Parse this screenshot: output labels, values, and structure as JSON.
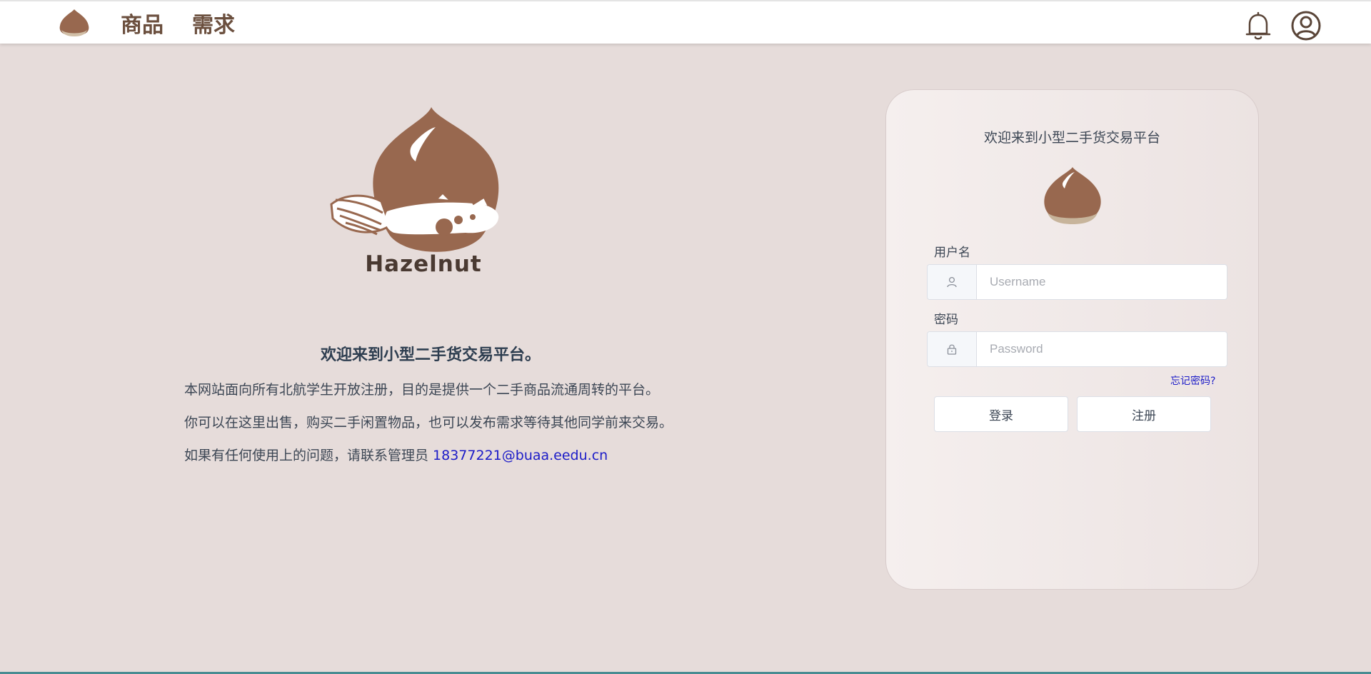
{
  "colors": {
    "page_background": "#e6dcda",
    "brand_brown": "#98684f",
    "nav_text": "#6b4f3e",
    "link_blue": "#1c1cc8"
  },
  "navbar": {
    "logo_icon": "hazelnut-icon",
    "links": [
      {
        "label": "商品"
      },
      {
        "label": "需求"
      }
    ],
    "notification_icon": "bell-icon",
    "profile_icon": "user-circle-icon"
  },
  "hero": {
    "logo_icon": "hazelnut-squirrel-logo",
    "wordmark": "Hazelnut",
    "title": "欢迎来到小型二手货交易平台。",
    "lines": [
      "本网站面向所有北航学生开放注册，目的是提供一个二手商品流通周转的平台。",
      "你可以在这里出售，购买二手闲置物品，也可以发布需求等待其他同学前来交易。"
    ],
    "contact_prefix": "如果有任何使用上的问题，请联系管理员 ",
    "contact_email": "18377221@buaa.eedu.cn"
  },
  "login": {
    "title": "欢迎来到小型二手货交易平台",
    "logo_icon": "hazelnut-icon",
    "username": {
      "label": "用户名",
      "icon": "user-icon",
      "placeholder": "Username",
      "value": ""
    },
    "password": {
      "label": "密码",
      "icon": "lock-icon",
      "placeholder": "Password",
      "value": ""
    },
    "forgot_label": "忘记密码?",
    "login_label": "登录",
    "register_label": "注册"
  }
}
